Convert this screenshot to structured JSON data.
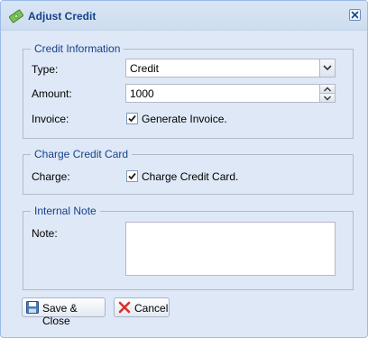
{
  "window": {
    "title": "Adjust Credit"
  },
  "credit_info": {
    "legend": "Credit Information",
    "type_label": "Type:",
    "type_value": "Credit",
    "amount_label": "Amount:",
    "amount_value": "1000",
    "invoice_label": "Invoice:",
    "generate_invoice_label": "Generate Invoice.",
    "generate_invoice_checked": true
  },
  "charge_card": {
    "legend": "Charge Credit Card",
    "charge_label": "Charge:",
    "charge_card_label": "Charge Credit Card.",
    "charge_card_checked": true
  },
  "internal_note": {
    "legend": "Internal Note",
    "note_label": "Note:",
    "note_value": ""
  },
  "buttons": {
    "save_close": "Save & Close",
    "cancel": "Cancel"
  },
  "colors": {
    "title_text": "#15428b",
    "legend_text": "#15428b",
    "panel_bg": "#dfe8f6"
  }
}
